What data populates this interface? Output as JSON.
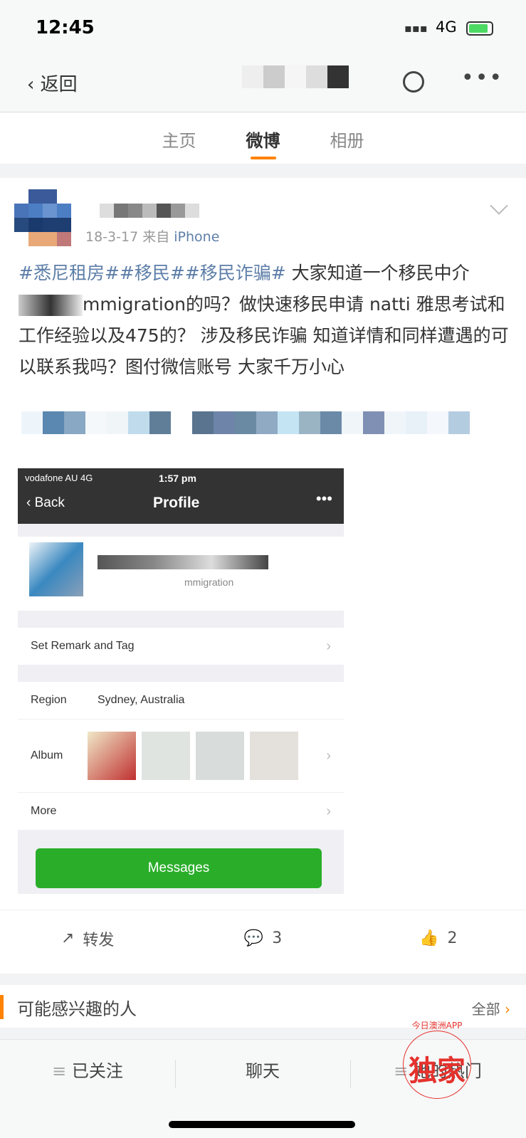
{
  "status": {
    "time": "12:45",
    "network": "4G"
  },
  "nav": {
    "back": "返回"
  },
  "tabs": [
    {
      "label": "主页"
    },
    {
      "label": "微博",
      "active": true
    },
    {
      "label": "相册"
    }
  ],
  "post": {
    "date": "18-3-17",
    "source_prefix": "来自",
    "source": "iPhone",
    "tags": "#悉尼租房##移民##移民诈骗#",
    "body1": " 大家知道一个移民中介",
    "body2": "mmigration的吗？做快速移民申请 natti 雅思考试和工作经验以及475的？ 涉及移民诈骗 知道详情和同样遭遇的可以联系我吗？图付微信账号 大家千万小心"
  },
  "screenshot": {
    "carrier": "vodafone AU  4G",
    "time": "1:57 pm",
    "back": "Back",
    "title": "Profile",
    "profile_sub": "mmigration",
    "rows": [
      {
        "label": "Set Remark and Tag"
      },
      {
        "label": "Region",
        "value": "Sydney, Australia"
      },
      {
        "label": "Album"
      },
      {
        "label": "More"
      }
    ],
    "messages": "Messages"
  },
  "actions": {
    "repost": "转发",
    "comments": "3",
    "likes": "2"
  },
  "recommend": {
    "title": "可能感兴趣的人",
    "all": "全部"
  },
  "bottom": {
    "follow": "已关注",
    "chat": "聊天",
    "hot": "她的热门"
  },
  "watermark": {
    "top": "今日澳洲APP",
    "main": "独家",
    "accent": "#e5322d"
  },
  "colors": {
    "accent": "#ff8200",
    "link": "#5d7ea8",
    "wechat_green": "#2aae2a"
  }
}
